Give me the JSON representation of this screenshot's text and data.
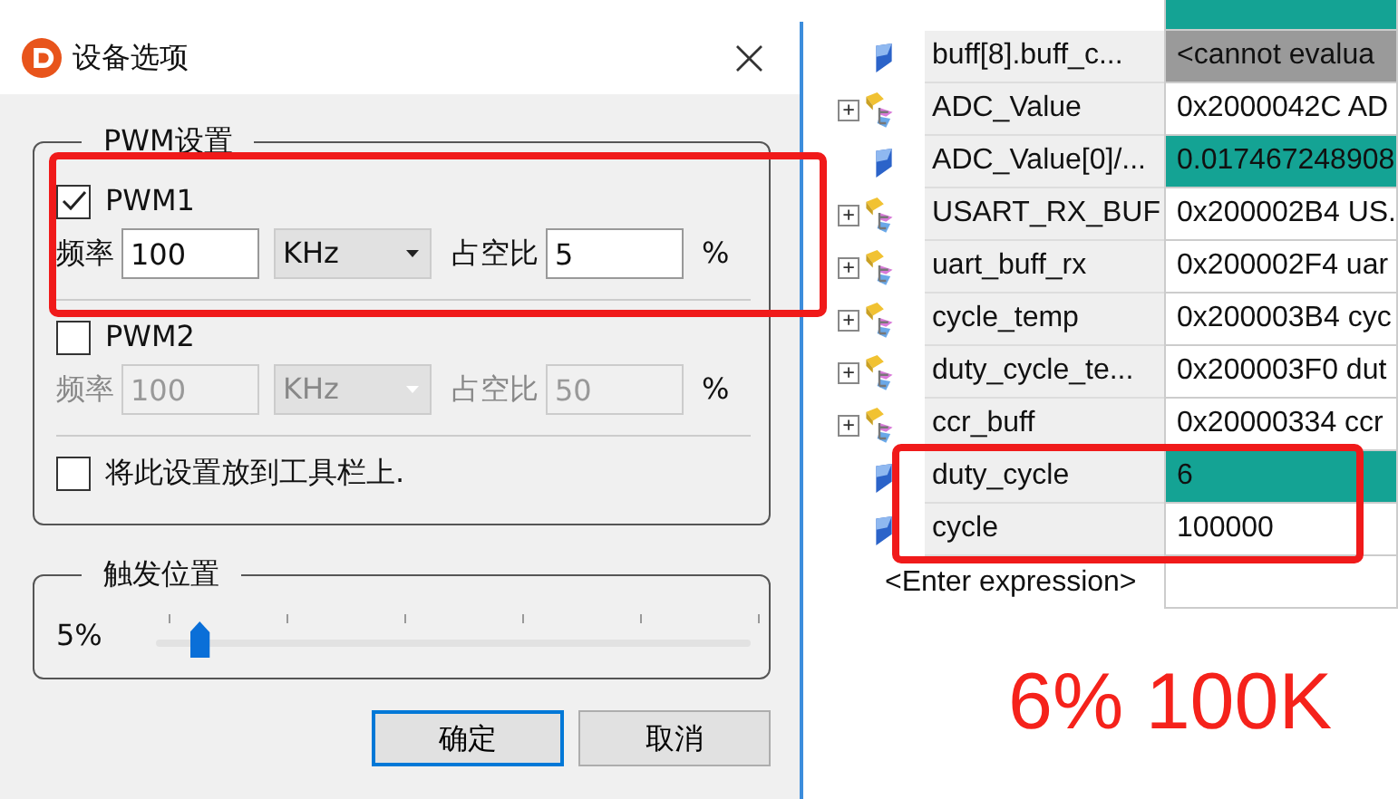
{
  "dialog": {
    "title": "设备选项",
    "close": "×",
    "pwm_group": {
      "legend": "PWM设置",
      "channels": [
        {
          "label": "PWM1",
          "checked": true,
          "disabled": false,
          "annotated": true,
          "freq_label": "频率",
          "freq": "100",
          "unit": "KHz",
          "duty_label": "占空比",
          "duty": "5",
          "percent": "%"
        },
        {
          "label": "PWM2",
          "checked": false,
          "disabled": true,
          "annotated": false,
          "freq_label": "频率",
          "freq": "100",
          "unit": "KHz",
          "duty_label": "占空比",
          "duty": "50",
          "percent": "%"
        }
      ],
      "toolbar_option": {
        "label": "将此设置放到工具栏上.",
        "checked": false
      }
    },
    "trigger_group": {
      "legend": "触发位置",
      "reading": "5%",
      "level": 0.05
    },
    "buttons": [
      {
        "label": "确定",
        "focused": true
      },
      {
        "label": "取消",
        "focused": false
      }
    ]
  },
  "watch": {
    "rows": [
      {
        "name": "buff[8].buff_c...",
        "value": "<cannot evalua",
        "kind": "scalar",
        "changed": false,
        "error": true
      },
      {
        "expander": "+",
        "name": "ADC_Value",
        "value": "0x2000042C AD",
        "kind": "struct",
        "changed": false,
        "error": false
      },
      {
        "name": "ADC_Value[0]/...",
        "value": "0.017467248908",
        "kind": "scalar",
        "changed": true,
        "error": false
      },
      {
        "expander": "+",
        "name": "USART_RX_BUF",
        "value": "0x200002B4 US.",
        "kind": "struct",
        "changed": false,
        "error": false
      },
      {
        "expander": "+",
        "name": "uart_buff_rx",
        "value": "0x200002F4 uar",
        "kind": "struct",
        "changed": false,
        "error": false
      },
      {
        "expander": "+",
        "name": "cycle_temp",
        "value": "0x200003B4 cyc",
        "kind": "struct",
        "changed": false,
        "error": false
      },
      {
        "expander": "+",
        "name": "duty_cycle_te...",
        "value": "0x200003F0 dut",
        "kind": "struct",
        "changed": false,
        "error": false
      },
      {
        "expander": "+",
        "name": "ccr_buff",
        "value": "0x20000334 ccr",
        "kind": "struct",
        "changed": false,
        "error": false
      }
    ],
    "boxed_rows": [
      {
        "name": "duty_cycle",
        "value": "6",
        "kind": "scalar",
        "changed": true,
        "error": false
      },
      {
        "name": "cycle",
        "value": "100000",
        "kind": "scalar",
        "changed": false,
        "error": false
      }
    ],
    "placeholder": "<Enter expression>"
  },
  "caption": "6% 100K"
}
